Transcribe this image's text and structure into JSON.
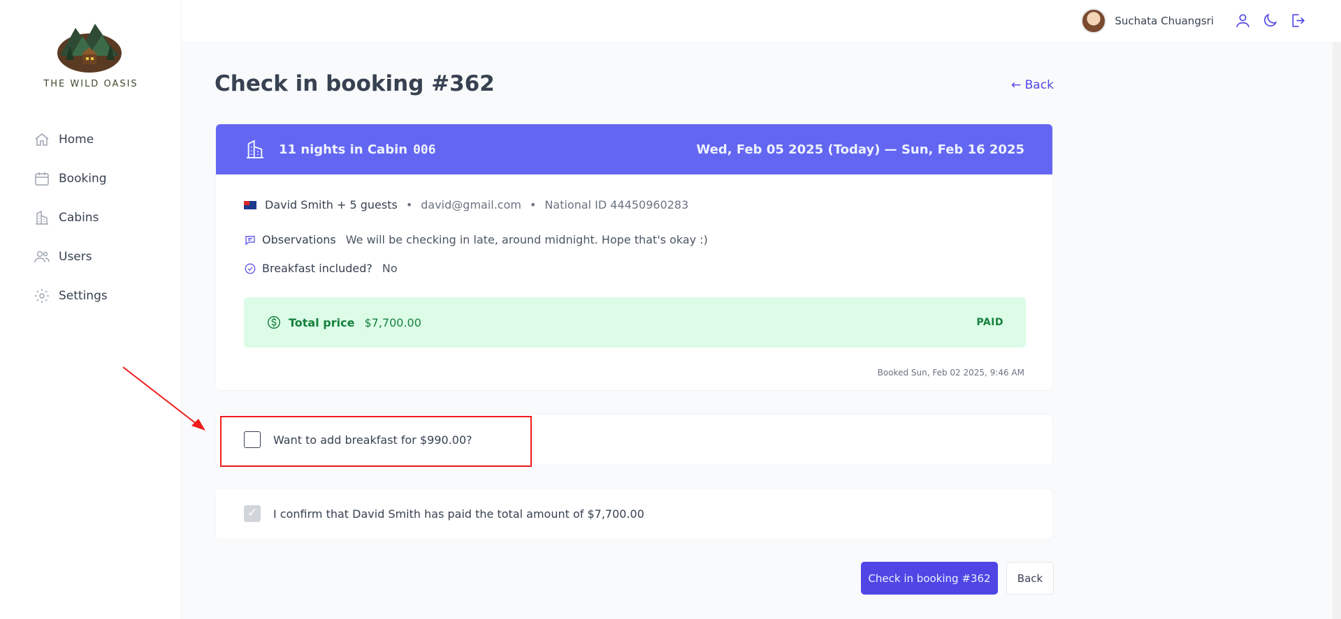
{
  "app": {
    "logo_text": "THE WILD OASIS"
  },
  "sidebar": {
    "items": [
      {
        "label": "Home",
        "icon": "home-icon"
      },
      {
        "label": "Booking",
        "icon": "calendar-icon"
      },
      {
        "label": "Cabins",
        "icon": "building-icon"
      },
      {
        "label": "Users",
        "icon": "users-icon"
      },
      {
        "label": "Settings",
        "icon": "gear-icon"
      }
    ]
  },
  "header": {
    "user_name": "Suchata Chuangsri",
    "icons": [
      "user-icon",
      "moon-icon",
      "logout-icon"
    ]
  },
  "page": {
    "title": "Check in booking #362",
    "back_link": "← Back"
  },
  "booking": {
    "nights_label": "11 nights in Cabin",
    "cabin": "006",
    "dates": "Wed, Feb 05 2025 (Today) — Sun, Feb 16 2025",
    "guest": "David Smith + 5 guests",
    "separator": "•",
    "email": "david@gmail.com",
    "national_id": "National ID 44450960283",
    "observations_label": "Observations",
    "observations": "We will be checking in late, around midnight. Hope that's okay :)",
    "breakfast_label": "Breakfast included?",
    "breakfast_value": "No",
    "total_label": "Total price",
    "total_value": "$7,700.00",
    "status": "PAID",
    "booked_at": "Booked Sun, Feb 02 2025, 9:46 AM"
  },
  "options": {
    "breakfast": "Want to add breakfast for $990.00?",
    "confirm": "I confirm that David Smith has paid the total amount of $7,700.00"
  },
  "actions": {
    "checkin": "Check in booking #362",
    "back": "Back"
  },
  "colors": {
    "accent": "#4f46e5",
    "header_band": "#6366f1",
    "paid_bg": "#dcfce7",
    "paid_text": "#15803d",
    "annotation": "#ef1c1c"
  }
}
